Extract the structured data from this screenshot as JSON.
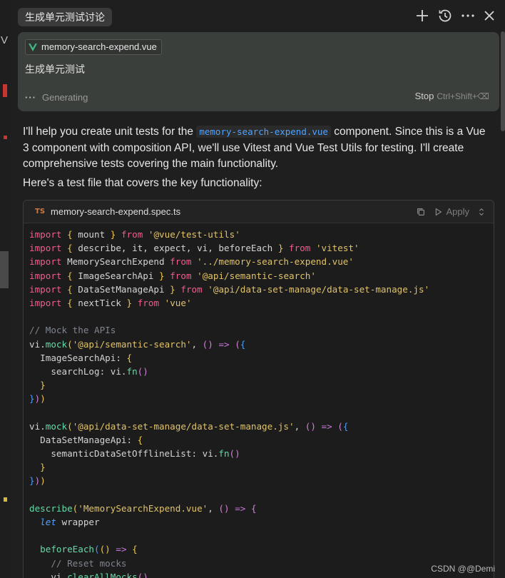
{
  "header": {
    "title": "生成单元测试讨论"
  },
  "prompt_card": {
    "file_name": "memory-search-expend.vue",
    "prompt_text": "生成单元测试",
    "status_text": "Generating",
    "stop_label": "Stop",
    "stop_shortcut": "Ctrl+Shift+⌫"
  },
  "response": {
    "p1_before": "I'll help you create unit tests for the ",
    "p1_code": "memory-search-expend.vue",
    "p1_after": " component. Since this is a Vue 3 component with composition API, we'll use Vitest and Vue Test Utils for testing. I'll create comprehensive tests covering the main functionality.",
    "p2": "Here's a test file that covers the key functionality:"
  },
  "codeblock": {
    "lang_badge": "TS",
    "file_name": "memory-search-expend.spec.ts",
    "apply_label": "Apply"
  },
  "watermark": "CSDN @@Demi",
  "colors": {
    "keyword": "#f05d8e",
    "string": "#e0c26a",
    "comment": "#7f848e",
    "function": "#66d9a6",
    "link": "#4fa3ff"
  }
}
